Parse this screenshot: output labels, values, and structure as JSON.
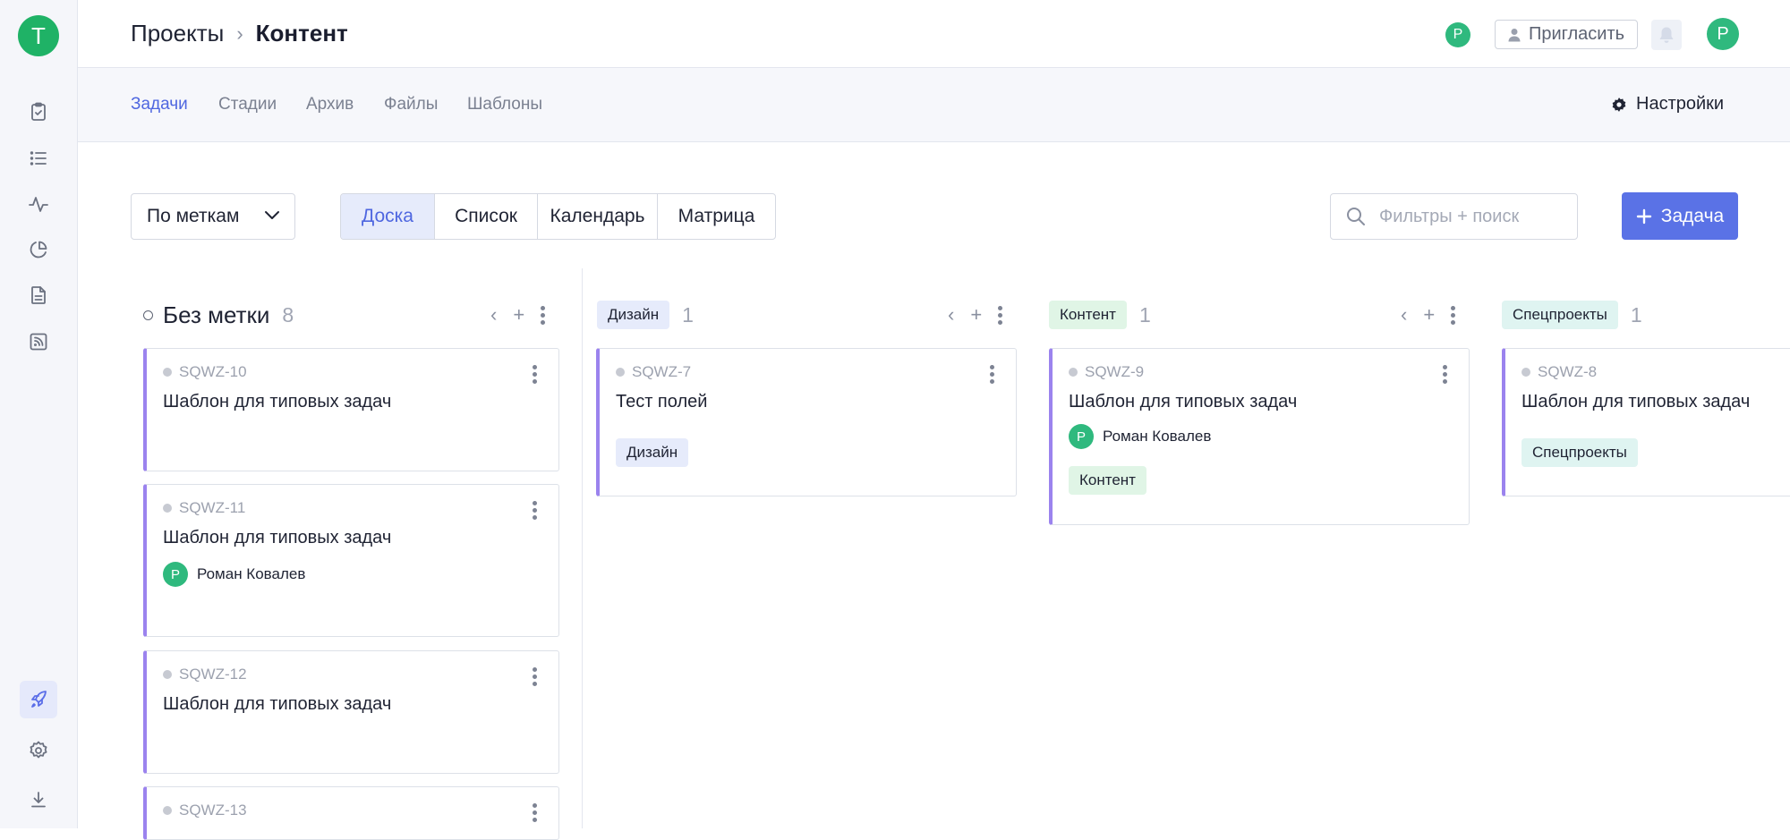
{
  "workspace": {
    "avatar_letter": "T"
  },
  "rail": {
    "items": [
      "tasks-icon",
      "list-icon",
      "activity-icon",
      "pie-chart-icon",
      "document-icon",
      "rss-icon"
    ],
    "bottom": [
      "rocket-icon",
      "gear-icon",
      "download-icon"
    ]
  },
  "header": {
    "breadcrumb_parent": "Проекты",
    "breadcrumb_separator": "›",
    "breadcrumb_current": "Контент",
    "member_avatar_letter": "Р",
    "invite_label": "Пригласить",
    "user_avatar_letter": "Р"
  },
  "subnav": {
    "tabs": [
      "Задачи",
      "Стадии",
      "Архив",
      "Файлы",
      "Шаблоны"
    ],
    "active_tab": "Задачи",
    "settings_label": "Настройки"
  },
  "toolbar": {
    "group_by": "По меткам",
    "views": [
      "Доска",
      "Список",
      "Календарь",
      "Матрица"
    ],
    "active_view": "Доска",
    "search_placeholder": "Фильтры + поиск",
    "add_task_label": "Задача"
  },
  "colors": {
    "accent": "#5a72e6",
    "card_stripe": "#9b83ee",
    "avatar_green": "#2fb97e",
    "tag_design_bg": "#e6ebfb",
    "tag_content_bg": "#e0f5e6",
    "tag_special_bg": "#dff4f1"
  },
  "columns": [
    {
      "title": "Без метки",
      "count": "8",
      "cards": [
        {
          "id": "SQWZ-10",
          "title": "Шаблон для типовых задач"
        },
        {
          "id": "SQWZ-11",
          "title": "Шаблон для типовых задач",
          "assignee": "Роман Ковалев",
          "assignee_letter": "Р"
        },
        {
          "id": "SQWZ-12",
          "title": "Шаблон для типовых задач"
        },
        {
          "id": "SQWZ-13"
        }
      ]
    },
    {
      "title": "Дизайн",
      "count": "1",
      "cards": [
        {
          "id": "SQWZ-7",
          "title": "Тест полей",
          "tag": "Дизайн"
        }
      ]
    },
    {
      "title": "Контент",
      "count": "1",
      "cards": [
        {
          "id": "SQWZ-9",
          "title": "Шаблон для типовых задач",
          "assignee": "Роман Ковалев",
          "assignee_letter": "Р",
          "tag": "Контент"
        }
      ]
    },
    {
      "title": "Спецпроекты",
      "count": "1",
      "cards": [
        {
          "id": "SQWZ-8",
          "title": "Шаблон для типовых задач",
          "tag": "Спецпроекты"
        }
      ]
    }
  ]
}
